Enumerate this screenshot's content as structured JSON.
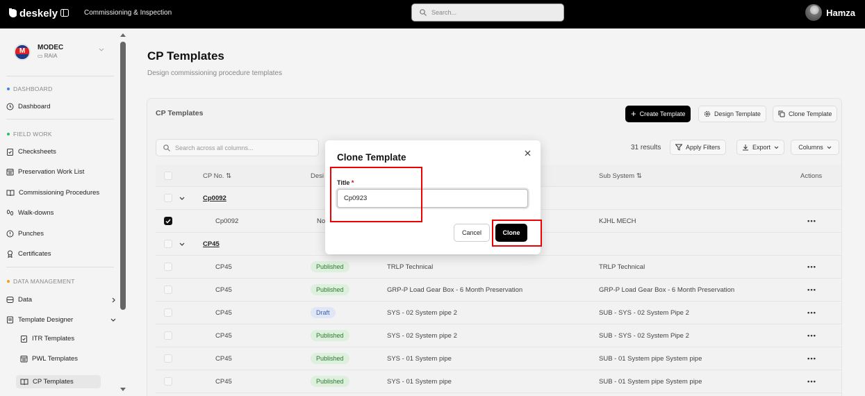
{
  "topbar": {
    "brand": "deskely",
    "breadcrumb": "Commissioning & Inspection",
    "search_placeholder": "Search...",
    "user_name": "Hamza"
  },
  "sidebar": {
    "org_name": "MODEC",
    "org_sub": "RAIA",
    "sections": {
      "dashboard": "DASHBOARD",
      "field_work": "FIELD WORK",
      "data_management": "DATA MANAGEMENT"
    },
    "section_colors": {
      "dashboard": "#3b82f6",
      "field_work": "#22c55e",
      "data_management": "#f59e0b"
    },
    "items": {
      "dashboard": "Dashboard",
      "checksheets": "Checksheets",
      "preservation": "Preservation Work List",
      "commissioning": "Commissioning Procedures",
      "walkdowns": "Walk-downs",
      "punches": "Punches",
      "certificates": "Certificates",
      "data": "Data",
      "template_designer": "Template Designer",
      "itr": "ITR Templates",
      "pwl": "PWL Templates",
      "cp": "CP Templates"
    }
  },
  "page": {
    "title": "CP Templates",
    "subtitle": "Design commissioning procedure templates"
  },
  "card": {
    "title": "CP Templates",
    "create_label": "Create Template",
    "design_label": "Design Template",
    "clone_label": "Clone Template",
    "search_placeholder": "Search across all columns...",
    "results": "31 results",
    "apply_filters": "Apply Filters",
    "export": "Export",
    "columns": "Columns"
  },
  "table": {
    "headers": {
      "cp_no": "CP No. ⇅",
      "design": "Desi",
      "sub_system": "Sub System ⇅",
      "actions": "Actions"
    },
    "groups": [
      "Cp0092",
      "CP45"
    ],
    "rows": [
      {
        "cp": "Cp0092",
        "status": "No",
        "system": "",
        "sub": "KJHL MECH",
        "actions": "•••"
      },
      {
        "cp": "CP45",
        "status": "Published",
        "system": "TRLP Technical",
        "sub": "TRLP Technical",
        "actions": "•••"
      },
      {
        "cp": "CP45",
        "status": "Published",
        "system": "GRP-P Load Gear Box - 6 Month Preservation",
        "sub": "GRP-P Load Gear Box - 6 Month Preservation",
        "actions": "•••"
      },
      {
        "cp": "CP45",
        "status": "Draft",
        "system": "SYS - 02 System pipe 2",
        "sub": "SUB - SYS - 02 System Pipe 2",
        "actions": "•••"
      },
      {
        "cp": "CP45",
        "status": "Published",
        "system": "SYS - 02 System pipe 2",
        "sub": "SUB - SYS - 02 System Pipe 2",
        "actions": "•••"
      },
      {
        "cp": "CP45",
        "status": "Published",
        "system": "SYS - 01 System pipe",
        "sub": "SUB - 01 System pipe System pipe",
        "actions": "•••"
      },
      {
        "cp": "CP45",
        "status": "Published",
        "system": "SYS - 01 System pipe",
        "sub": "SUB - 01 System pipe System pipe",
        "actions": "•••"
      }
    ]
  },
  "modal": {
    "title": "Clone Template",
    "field_label": "Title",
    "required_mark": "*",
    "field_value": "Cp0923",
    "cancel": "Cancel",
    "clone": "Clone"
  }
}
